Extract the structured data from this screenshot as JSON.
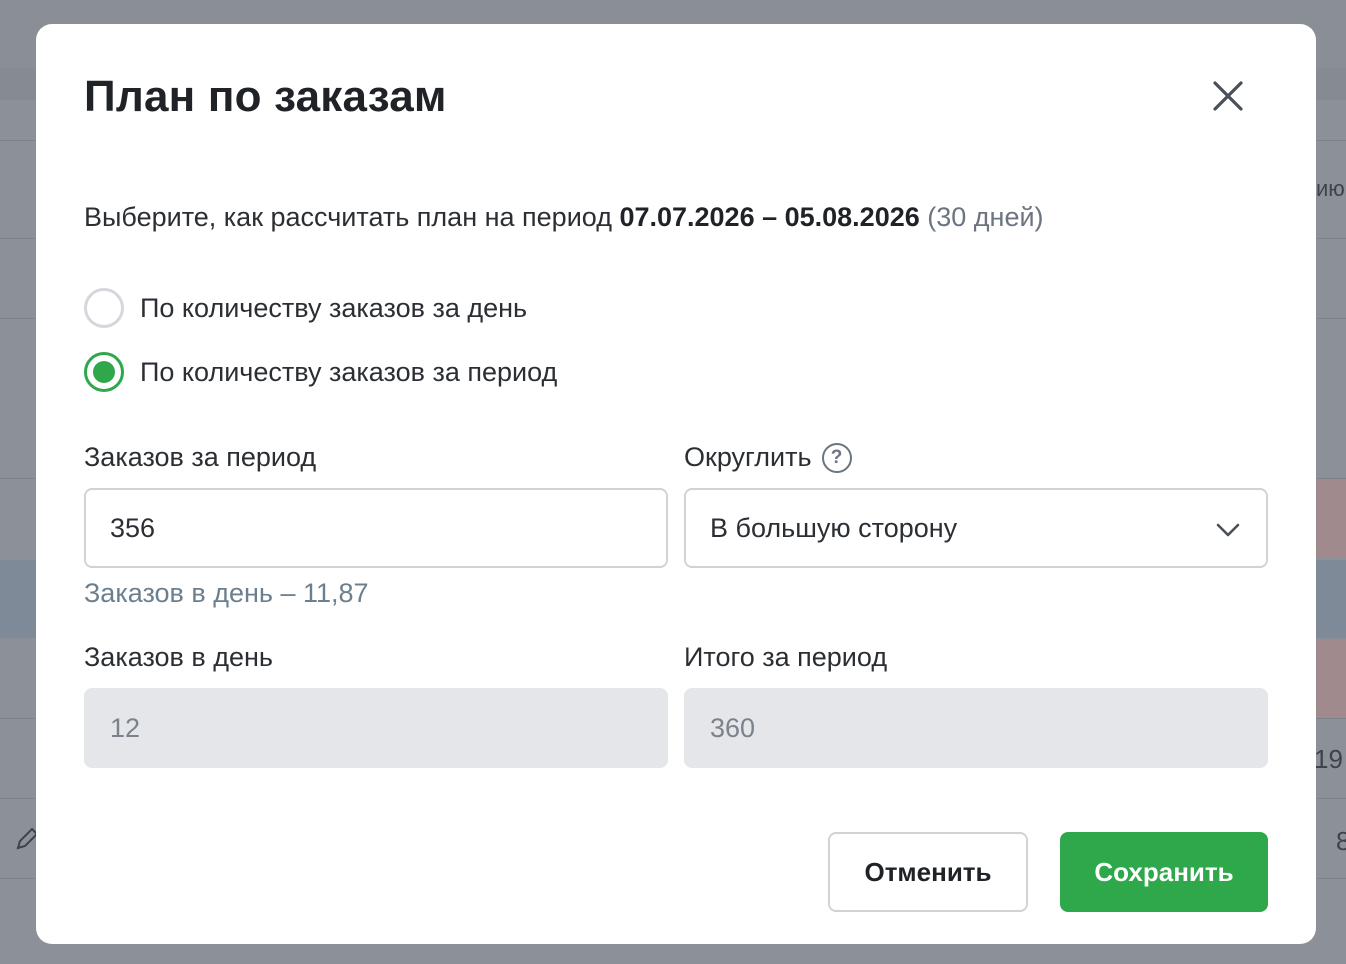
{
  "modal": {
    "title": "План по заказам",
    "intro_text": "Выберите, как рассчитать план на период ",
    "period_dates": "07.07.2026 – 05.08.2026",
    "period_days": "(30 дней)",
    "radio_options": [
      {
        "label": "По количеству заказов за день",
        "checked": false
      },
      {
        "label": "По количеству заказов за период",
        "checked": true
      }
    ],
    "orders_period": {
      "label": "Заказов за период",
      "value": "356",
      "hint": "Заказов в день – 11,87"
    },
    "rounding": {
      "label": "Округлить",
      "value": "В большую сторону",
      "help_icon": "question-circle-icon"
    },
    "orders_day": {
      "label": "Заказов в день",
      "value": "12"
    },
    "total_period": {
      "label": "Итого за период",
      "value": "360"
    },
    "buttons": {
      "cancel": "Отменить",
      "save": "Сохранить"
    },
    "close_icon": "close-icon"
  },
  "background": {
    "fragments": [
      "ию",
      "19",
      "8"
    ]
  },
  "colors": {
    "accent_green": "#2ea84a",
    "overlay": "#8c9098",
    "text_primary": "#1f2226",
    "text_muted": "#6b7480",
    "disabled_bg": "#e4e6ea"
  }
}
